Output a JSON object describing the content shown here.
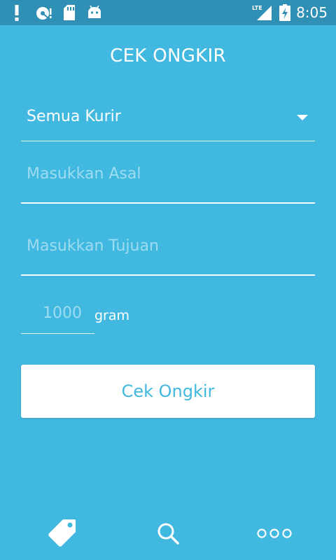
{
  "status_bar": {
    "time": "8:05",
    "network_label": "LTE",
    "icons": [
      "alert-icon",
      "sync-icon",
      "sd-card-icon",
      "android-icon",
      "lte-signal-icon",
      "battery-charging-icon"
    ]
  },
  "header": {
    "title": "CEK ONGKIR"
  },
  "form": {
    "courier": {
      "selected": "Semua Kurir"
    },
    "origin": {
      "value": "",
      "placeholder": "Masukkan Asal"
    },
    "destination": {
      "value": "",
      "placeholder": "Masukkan Tujuan"
    },
    "weight": {
      "value": "",
      "placeholder": "1000",
      "unit": "gram"
    },
    "submit_label": "Cek Ongkir"
  },
  "bottom_nav": {
    "items": [
      {
        "icon": "tag-icon"
      },
      {
        "icon": "search-icon"
      },
      {
        "icon": "more-icon"
      }
    ]
  },
  "colors": {
    "background": "#41b8e0",
    "status_bar": "#2f8fb4",
    "button_bg": "#ffffff",
    "button_text": "#41b8e0",
    "placeholder": "#9ddcf1"
  }
}
